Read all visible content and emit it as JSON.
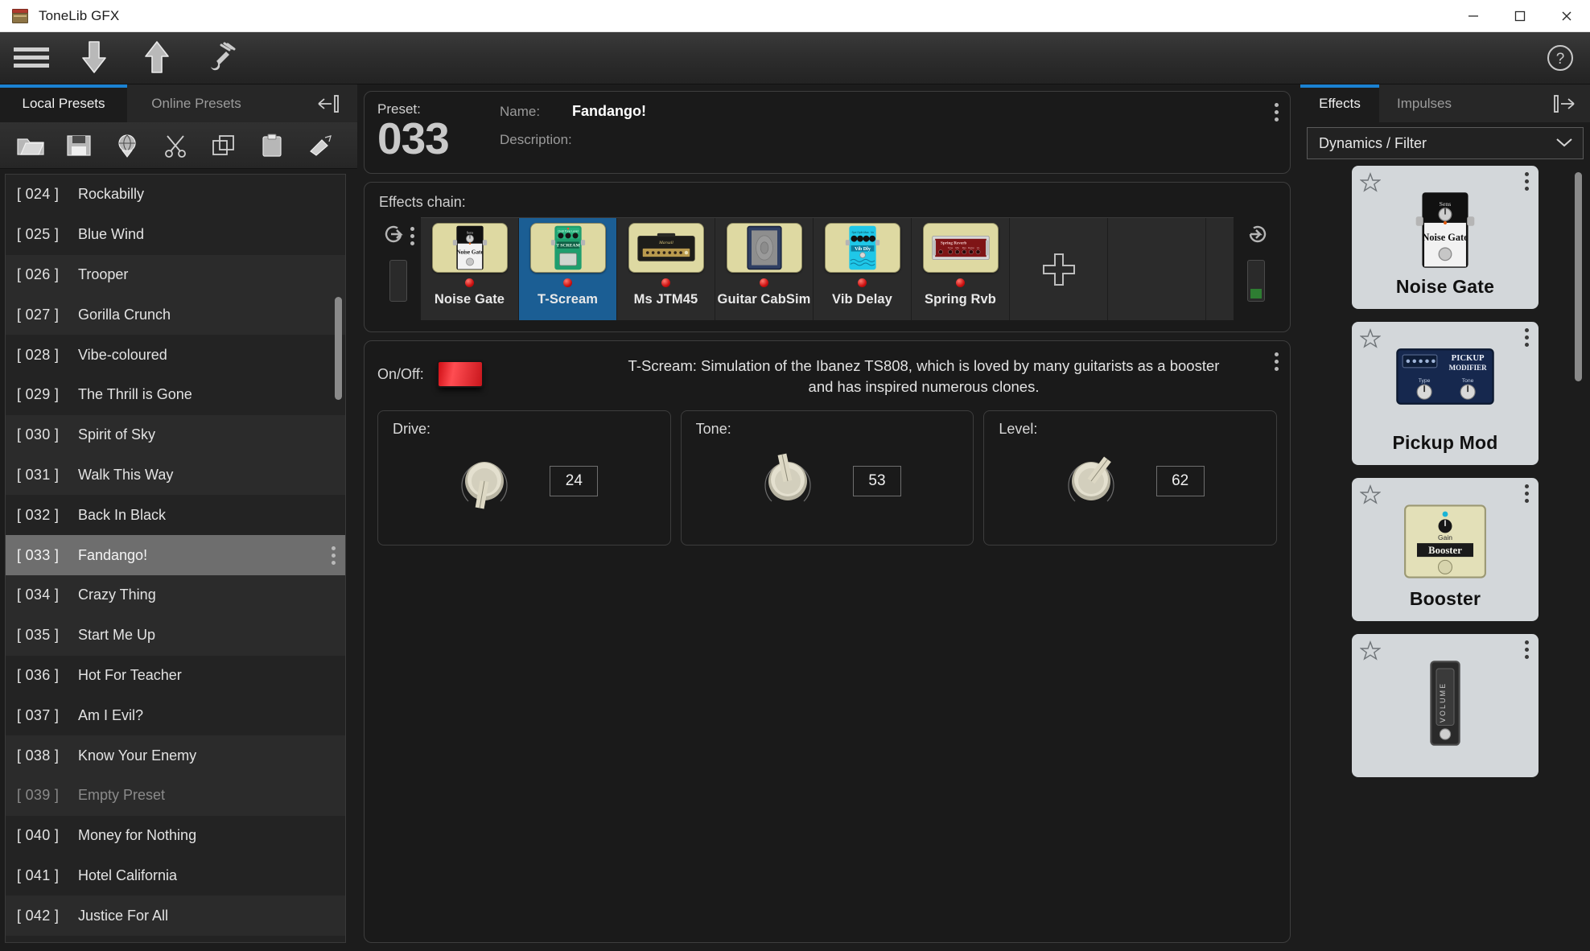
{
  "window": {
    "title": "ToneLib GFX",
    "minimize_label": "Minimize",
    "maximize_label": "Maximize",
    "close_label": "Close"
  },
  "toolbar": {
    "menu_icon": "hamburger-menu-icon",
    "download_icon": "download-arrow-icon",
    "upload_icon": "upload-arrow-icon",
    "tuner_icon": "tuner-fork-icon",
    "help_icon": "help-question-icon"
  },
  "left_panel": {
    "tabs": [
      {
        "label": "Local Presets",
        "active": true
      },
      {
        "label": "Online Presets",
        "active": false
      }
    ],
    "collapse_icon": "collapse-left-icon",
    "icon_buttons": [
      {
        "name": "open-folder-icon"
      },
      {
        "name": "save-preset-icon"
      },
      {
        "name": "upload-globe-icon"
      },
      {
        "name": "cut-icon"
      },
      {
        "name": "copy-icon"
      },
      {
        "name": "paste-icon"
      },
      {
        "name": "clear-icon"
      }
    ],
    "presets": [
      {
        "num": "[ 024 ]",
        "name": "Rockabilly",
        "selected": false,
        "empty": false
      },
      {
        "num": "[ 025 ]",
        "name": "Blue Wind",
        "selected": false,
        "empty": false
      },
      {
        "num": "[ 026 ]",
        "name": "Trooper",
        "selected": false,
        "empty": false
      },
      {
        "num": "[ 027 ]",
        "name": "Gorilla Crunch",
        "selected": false,
        "empty": false
      },
      {
        "num": "[ 028 ]",
        "name": "Vibe-coloured",
        "selected": false,
        "empty": false
      },
      {
        "num": "[ 029 ]",
        "name": "The Thrill is Gone",
        "selected": false,
        "empty": false
      },
      {
        "num": "[ 030 ]",
        "name": "Spirit of Sky",
        "selected": false,
        "empty": false
      },
      {
        "num": "[ 031 ]",
        "name": "Walk This Way",
        "selected": false,
        "empty": false
      },
      {
        "num": "[ 032 ]",
        "name": "Back In Black",
        "selected": false,
        "empty": false
      },
      {
        "num": "[ 033 ]",
        "name": "Fandango!",
        "selected": true,
        "empty": false
      },
      {
        "num": "[ 034 ]",
        "name": "Crazy Thing",
        "selected": false,
        "empty": false
      },
      {
        "num": "[ 035 ]",
        "name": "Start Me Up",
        "selected": false,
        "empty": false
      },
      {
        "num": "[ 036 ]",
        "name": "Hot For Teacher",
        "selected": false,
        "empty": false
      },
      {
        "num": "[ 037 ]",
        "name": "Am I Evil?",
        "selected": false,
        "empty": false
      },
      {
        "num": "[ 038 ]",
        "name": "Know Your Enemy",
        "selected": false,
        "empty": false
      },
      {
        "num": "[ 039 ]",
        "name": "Empty Preset",
        "selected": false,
        "empty": true
      },
      {
        "num": "[ 040 ]",
        "name": "Money for Nothing",
        "selected": false,
        "empty": false
      },
      {
        "num": "[ 041 ]",
        "name": "Hotel California",
        "selected": false,
        "empty": false
      },
      {
        "num": "[ 042 ]",
        "name": "Justice For All",
        "selected": false,
        "empty": false
      }
    ]
  },
  "preset_header": {
    "preset_label": "Preset:",
    "number": "033",
    "name_label": "Name:",
    "name_value": "Fandango!",
    "description_label": "Description:",
    "description_value": "",
    "menu_icon": "kebab-menu-icon"
  },
  "effects_chain": {
    "title": "Effects chain:",
    "input_icon": "signal-input-icon",
    "output_icon": "signal-output-icon",
    "add_icon": "add-plus-icon",
    "slots": [
      {
        "label": "Noise Gate",
        "selected": false,
        "led_on": true,
        "kind": "noisegate"
      },
      {
        "label": "T-Scream",
        "selected": true,
        "led_on": true,
        "kind": "tscream"
      },
      {
        "label": "Ms JTM45",
        "selected": false,
        "led_on": true,
        "kind": "amp"
      },
      {
        "label": "Guitar CabSim",
        "selected": false,
        "led_on": true,
        "kind": "cab"
      },
      {
        "label": "Vib Delay",
        "selected": false,
        "led_on": true,
        "kind": "vibdelay"
      },
      {
        "label": "Spring Rvb",
        "selected": false,
        "led_on": true,
        "kind": "spring"
      }
    ]
  },
  "effect_params": {
    "onoff_label": "On/Off:",
    "onoff_state": "on",
    "description": "T-Scream:  Simulation of the Ibanez TS808, which is loved by many guitarists as a booster and has inspired numerous clones.",
    "menu_icon": "kebab-menu-icon",
    "knobs": [
      {
        "label": "Drive:",
        "value": "24",
        "angle": 190
      },
      {
        "label": "Tone:",
        "value": "53",
        "angle": 348
      },
      {
        "label": "Level:",
        "value": "62",
        "angle": 37
      }
    ]
  },
  "right_panel": {
    "tabs": [
      {
        "label": "Effects",
        "active": true
      },
      {
        "label": "Impulses",
        "active": false
      }
    ],
    "expand_icon": "expand-right-icon",
    "category": "Dynamics / Filter",
    "dropdown_icon": "chevron-down-icon",
    "cards": [
      {
        "name": "Noise Gate",
        "favorite": false,
        "kind": "noisegate"
      },
      {
        "name": "Pickup Mod",
        "favorite": false,
        "kind": "pickup"
      },
      {
        "name": "Booster",
        "favorite": false,
        "kind": "booster"
      },
      {
        "name": "",
        "favorite": false,
        "kind": "volume"
      }
    ],
    "star_icon": "favorite-star-icon",
    "card_menu_icon": "kebab-menu-icon"
  },
  "colors": {
    "accent_blue": "#1b82d2",
    "selected_slot": "#1b5e94",
    "led_red": "#cc1010",
    "panel_bg": "#1c1c1c",
    "card_bg": "#d3d7da"
  }
}
